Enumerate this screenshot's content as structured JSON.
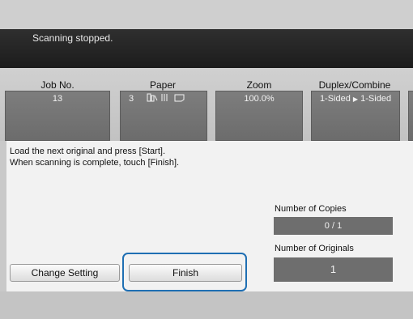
{
  "status": {
    "message": "Scanning stopped."
  },
  "job_info": {
    "job_no": {
      "label": "Job No.",
      "value": "13"
    },
    "paper": {
      "label": "Paper",
      "count": "3",
      "icon": "paper-tray-icons"
    },
    "zoom": {
      "label": "Zoom",
      "value": "100.0%"
    },
    "duplex": {
      "label": "Duplex/Combine",
      "value_left": "1-Sided",
      "value_right": "1-Sided",
      "arrow_icon": "right-triangle-icon"
    }
  },
  "message": {
    "line1": "Load the next original and press [Start].",
    "line2": "When scanning is complete, touch [Finish]."
  },
  "copies": {
    "label": "Number of Copies",
    "value": "0 / 1"
  },
  "originals": {
    "label": "Number of Originals",
    "value": "1"
  },
  "buttons": {
    "change_setting": "Change Setting",
    "finish": "Finish"
  },
  "colors": {
    "highlight_ring": "#1f6fb3",
    "status_bar": "#1c1c1c",
    "value_box": "#6e6e6e"
  }
}
